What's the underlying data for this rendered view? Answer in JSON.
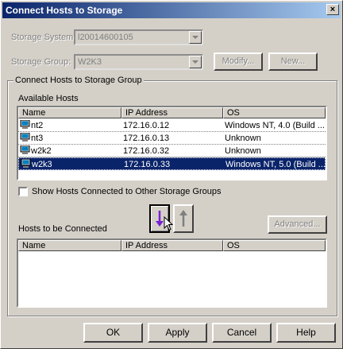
{
  "window": {
    "title": "Connect Hosts to Storage",
    "close_glyph": "×"
  },
  "storage_system": {
    "label": "Storage System:",
    "value": "l20014600105"
  },
  "storage_group": {
    "label": "Storage Group:",
    "value": "W2K3",
    "modify_label": "Modify...",
    "new_label": "New..."
  },
  "group": {
    "caption": "Connect Hosts to Storage Group"
  },
  "available": {
    "label": "Available Hosts",
    "columns": [
      "Name",
      "IP Address",
      "OS"
    ],
    "rows": [
      {
        "name": "nt2",
        "ip": "172.16.0.12",
        "os": "Windows NT, 4.0 (Build ...",
        "selected": false
      },
      {
        "name": "nt3",
        "ip": "172.16.0.13",
        "os": "Unknown",
        "selected": false
      },
      {
        "name": "w2k2",
        "ip": "172.16.0.32",
        "os": "Unknown",
        "selected": false
      },
      {
        "name": "w2k3",
        "ip": "172.16.0.33",
        "os": "Windows NT, 5.0 (Build ...",
        "selected": true
      }
    ]
  },
  "show_hosts": {
    "label": "Show Hosts Connected to Other Storage Groups",
    "checked": false
  },
  "to_connect": {
    "label": "Hosts to be Connected",
    "advanced_label": "Advanced...",
    "columns": [
      "Name",
      "IP Address",
      "OS"
    ]
  },
  "footer": {
    "ok": "OK",
    "apply": "Apply",
    "cancel": "Cancel",
    "help": "Help"
  },
  "colors": {
    "selection": "#0a246a",
    "arrow_down": "#7a1fd6",
    "arrow_up": "#808080"
  },
  "icons": {
    "move_down": "arrow-down-icon",
    "move_up": "arrow-up-icon",
    "host": "computer-icon"
  }
}
